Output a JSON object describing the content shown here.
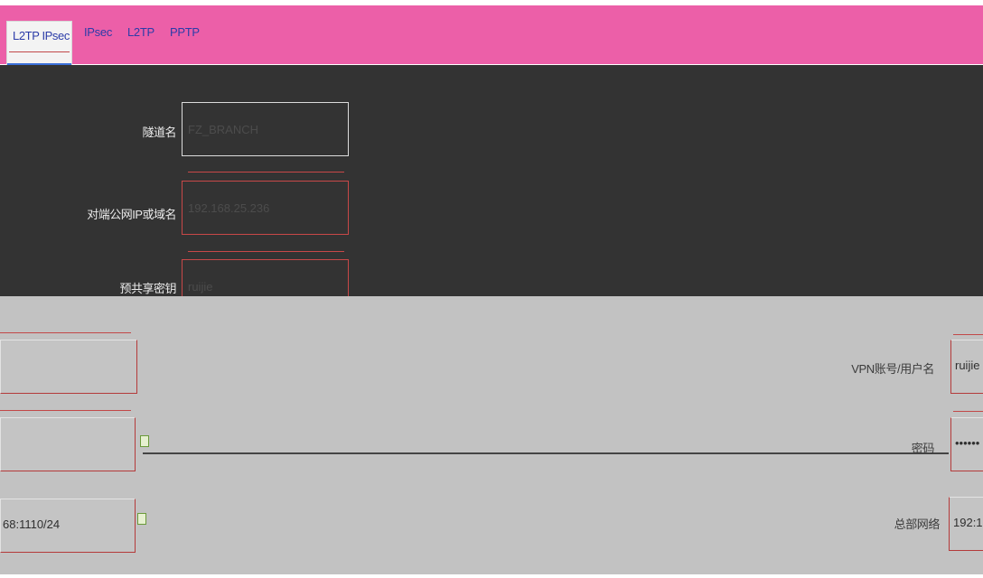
{
  "tabs": [
    {
      "label": "L2TP IPsec",
      "active": true
    },
    {
      "label": "IPsec",
      "active": false
    },
    {
      "label": "L2TP",
      "active": false
    },
    {
      "label": "PPTP",
      "active": false
    }
  ],
  "form": {
    "field1": {
      "label": "隧道名",
      "value": "FZ_BRANCH"
    },
    "field2": {
      "label": "对端公网IP或域名",
      "value": "192.168.25.236"
    },
    "field3": {
      "label": "预共享密钥",
      "value": "ruijie"
    }
  },
  "overlay": {
    "vpn_user": {
      "label": "VPN账号/用户名",
      "value": "ruijie"
    },
    "password": {
      "label": "密码",
      "value": "••••••"
    },
    "hq_network": {
      "label": "总部网络",
      "value": "192:1"
    },
    "local_network": {
      "value": "68:1110/24"
    }
  },
  "colors": {
    "topbar": "#ec5fa8",
    "tab_text": "#2c3ca8",
    "dark_panel": "#333333",
    "overlay": "#c2c2c2",
    "error_red": "#c84848"
  }
}
